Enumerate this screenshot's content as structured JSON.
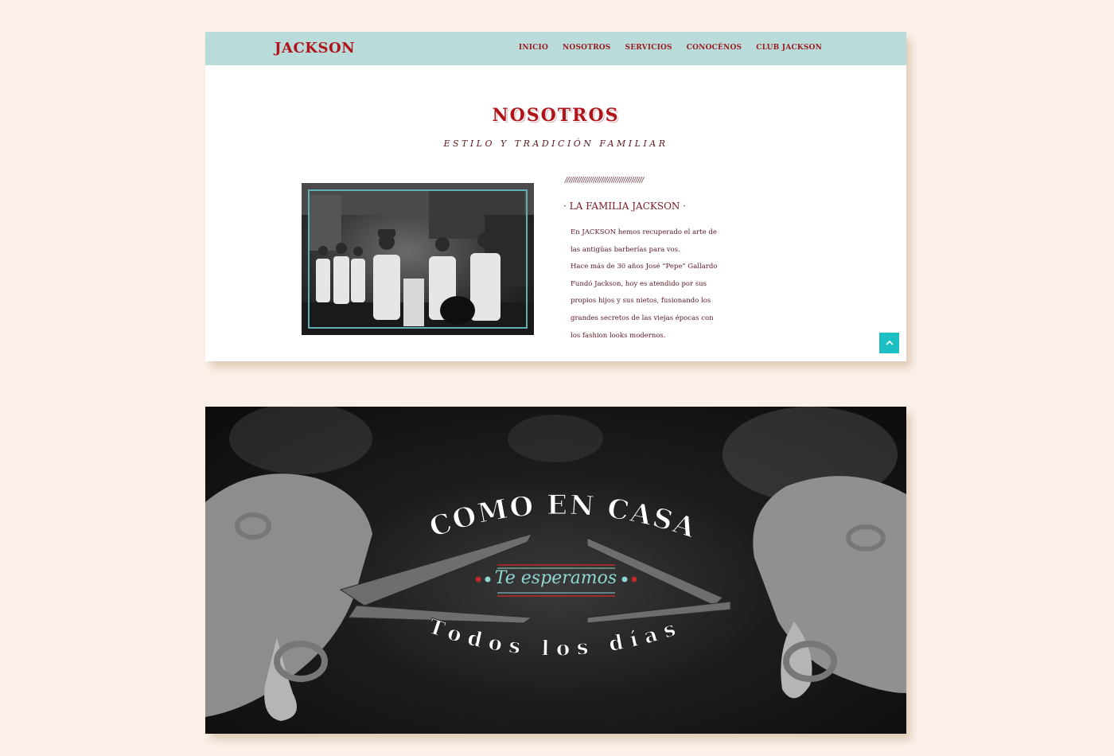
{
  "nav": {
    "logo": "JACKSON",
    "items": [
      "INICIO",
      "NOSOTROS",
      "SERVICIOS",
      "CONOCÉNOS",
      "CLUB JACKSON"
    ]
  },
  "about": {
    "title": "NOSOTROS",
    "subtitle": "ESTILO Y TRADICIÓN FAMILIAR",
    "divider": "///////////////////////////////////////",
    "family_title": "· LA FAMILIA JACKSON ·",
    "lines": [
      "En JACKSON hemos recuperado el arte de",
      "las antigüas barberías para vos.",
      "Hace más de 30 años José “Pepe” Gallardo",
      "Fundó Jackson, hoy es atendido por sus",
      "propios hijos y sus nietos, fusionando los",
      "grandes secretos de las viejas épocas con",
      "los fashion looks modernos."
    ]
  },
  "banner": {
    "arc_top": "COMO EN CASA",
    "middle": "Te esperamos",
    "arc_bottom": "Todos los días"
  },
  "colors": {
    "background": "#fbf1ea",
    "navbar": "#b9dbd9",
    "brand_red": "#b0141a",
    "text_maroon": "#5a1720",
    "accent_teal": "#1cc0c4",
    "banner_teal": "#8fd6d3"
  },
  "icons": {
    "scroll_top": "chevron-up-icon"
  }
}
